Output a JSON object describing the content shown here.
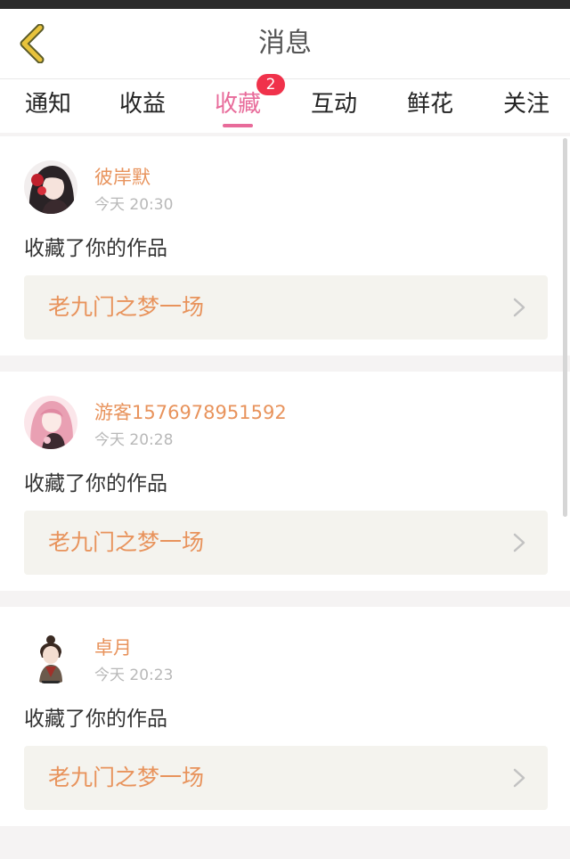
{
  "header": {
    "title": "消息"
  },
  "tabs": [
    {
      "label": "通知",
      "active": false
    },
    {
      "label": "收益",
      "active": false
    },
    {
      "label": "收藏",
      "active": true,
      "badge": "2"
    },
    {
      "label": "互动",
      "active": false
    },
    {
      "label": "鲜花",
      "active": false
    },
    {
      "label": "关注",
      "active": false
    }
  ],
  "notifications": [
    {
      "username": "彼岸默",
      "time": "今天 20:30",
      "action": "收藏了你的作品",
      "work_title": "老九门之梦一场"
    },
    {
      "username": "游客1576978951592",
      "time": "今天 20:28",
      "action": "收藏了你的作品",
      "work_title": "老九门之梦一场"
    },
    {
      "username": "卓月",
      "time": "今天 20:23",
      "action": "收藏了你的作品",
      "work_title": "老九门之梦一场"
    }
  ],
  "colors": {
    "accent": "#e86b9a",
    "username": "#e8935c",
    "badge": "#f0324b",
    "back_icon": "#e8c33c"
  },
  "icons": {
    "back": "chevron-left-icon",
    "item_arrow": "chevron-right-icon"
  }
}
